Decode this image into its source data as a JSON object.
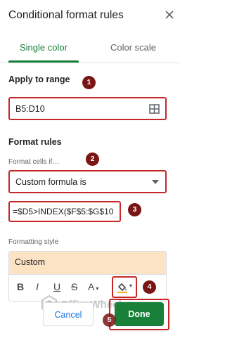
{
  "header": {
    "title": "Conditional format rules"
  },
  "tabs": [
    {
      "label": "Single color",
      "active": true
    },
    {
      "label": "Color scale",
      "active": false
    }
  ],
  "apply_range": {
    "label": "Apply to range",
    "value": "B5:D10"
  },
  "format_rules": {
    "label": "Format rules",
    "condition_label": "Format cells if…",
    "condition_value": "Custom formula is",
    "formula": "=$D5>INDEX($F$5:$G$10"
  },
  "formatting_style": {
    "label": "Formatting style",
    "preview": "Custom",
    "fill_color": "#fbe3c4"
  },
  "toolbar": {
    "bold": "B",
    "italic": "I",
    "underline": "U",
    "strike": "S",
    "text_color": "A"
  },
  "buttons": {
    "cancel": "Cancel",
    "done": "Done"
  },
  "markers": [
    "1",
    "2",
    "3",
    "4",
    "5"
  ],
  "watermark": "OfficeWheel",
  "colors": {
    "accent": "#188038",
    "annotation": "#c62828",
    "marker": "#7a1515"
  }
}
